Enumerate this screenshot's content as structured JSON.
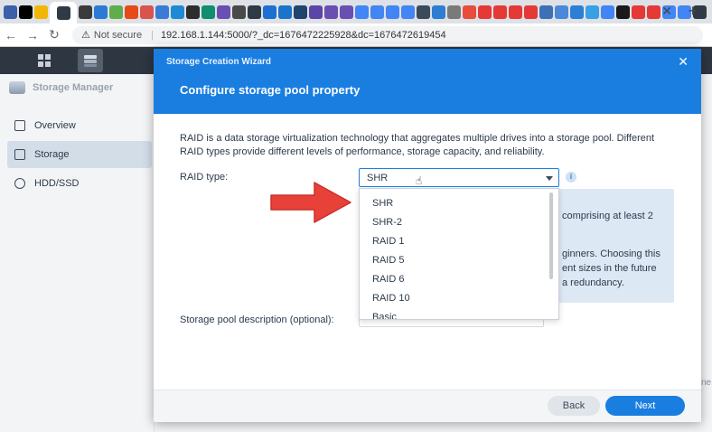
{
  "browser": {
    "url": "192.168.1.144:5000/?_dc=1676472225928&dc=1676472619454",
    "not_secure_label": "Not secure",
    "tab_icon_colors": [
      "#3b5fa8",
      "#000000",
      "#f2b705",
      "#3b3b3b",
      "#2a7ad6",
      "#5fae4b",
      "#e64a19",
      "#d9534f",
      "#3a7bd5",
      "#1e8ad6",
      "#2d2d2d",
      "#0e8f6e",
      "#6a4fb3",
      "#4a4a4a",
      "#2f3a44",
      "#1d6fd1",
      "#1a74c9",
      "#21446f",
      "#5a46a7",
      "#6a4fb3",
      "#6a4fb3",
      "#4285f4",
      "#4285f4",
      "#4285f4",
      "#4285f4",
      "#3b4b5c",
      "#2e7dd1",
      "#7a7a7a",
      "#e74c3c",
      "#e53935",
      "#e53935",
      "#e53935",
      "#e53935",
      "#3f6fb5",
      "#4b88d8",
      "#2d7fd6",
      "#3aa0e6",
      "#4285f4",
      "#1a1a1a",
      "#e53935",
      "#e53935",
      "#4285f4",
      "#4285f4",
      "#2f3a44"
    ]
  },
  "storage_manager": {
    "title": "Storage Manager",
    "nav": [
      {
        "label": "Overview"
      },
      {
        "label": "Storage"
      },
      {
        "label": "HDD/SSD"
      }
    ],
    "bg_fragment": "ne"
  },
  "wizard": {
    "window_title": "Storage Creation Wizard",
    "heading": "Configure storage pool property",
    "description": "RAID is a data storage virtualization technology that aggregates multiple drives into a storage pool. Different RAID types provide different levels of performance, storage capacity, and reliability.",
    "raid_type_label": "RAID type:",
    "raid_selected": "SHR",
    "raid_options": [
      "SHR",
      "SHR-2",
      "RAID 1",
      "RAID 5",
      "RAID 6",
      "RAID 10",
      "Basic"
    ],
    "info_panel_lines": [
      "comprising at least 2",
      "ginners. Choosing this",
      "ent sizes in the future",
      "a redundancy."
    ],
    "description_field_label": "Storage pool description (optional):",
    "back_label": "Back",
    "next_label": "Next"
  },
  "colors": {
    "accent": "#1a7ee0",
    "arrow": "#e8413a"
  }
}
